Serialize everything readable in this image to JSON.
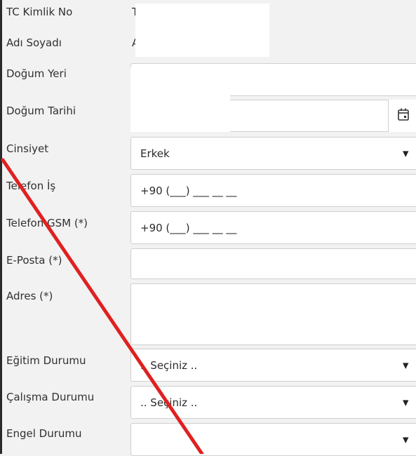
{
  "form": {
    "labels": {
      "tc_kimlik": "TC Kimlik No",
      "adi_soyadi": "Adı Soyadı",
      "dogum_yeri": "Doğum Yeri",
      "dogum_tarihi": "Doğum Tarihi",
      "cinsiyet": "Cinsiyet",
      "telefon_is": "Telefon İş",
      "telefon_gsm": "Telefon GSM (*)",
      "eposta": "E-Posta (*)",
      "adres": "Adres (*)",
      "egitim": "Eğitim Durumu",
      "calisma": "Çalışma Durumu",
      "engel": "Engel Durumu"
    },
    "values": {
      "tc_kimlik_partial": "T",
      "adi_soyadi_partial": "A",
      "cinsiyet": "Erkek",
      "telefon_is": "+90 (___) ___ __ __",
      "telefon_gsm": "+90 (___) ___ __ __",
      "eposta": "",
      "adres": "",
      "dogum_yeri": "",
      "dogum_tarihi": "",
      "egitim": ".. Seçiniz ..",
      "calisma": ".. Seçiniz ..",
      "engel": ""
    },
    "icons": {
      "dropdown": "▼",
      "calendar": "calendar-icon"
    }
  },
  "colors": {
    "annotation_line": "#e02020",
    "background": "#f2f2f2",
    "field_border": "#cfcfcf"
  }
}
